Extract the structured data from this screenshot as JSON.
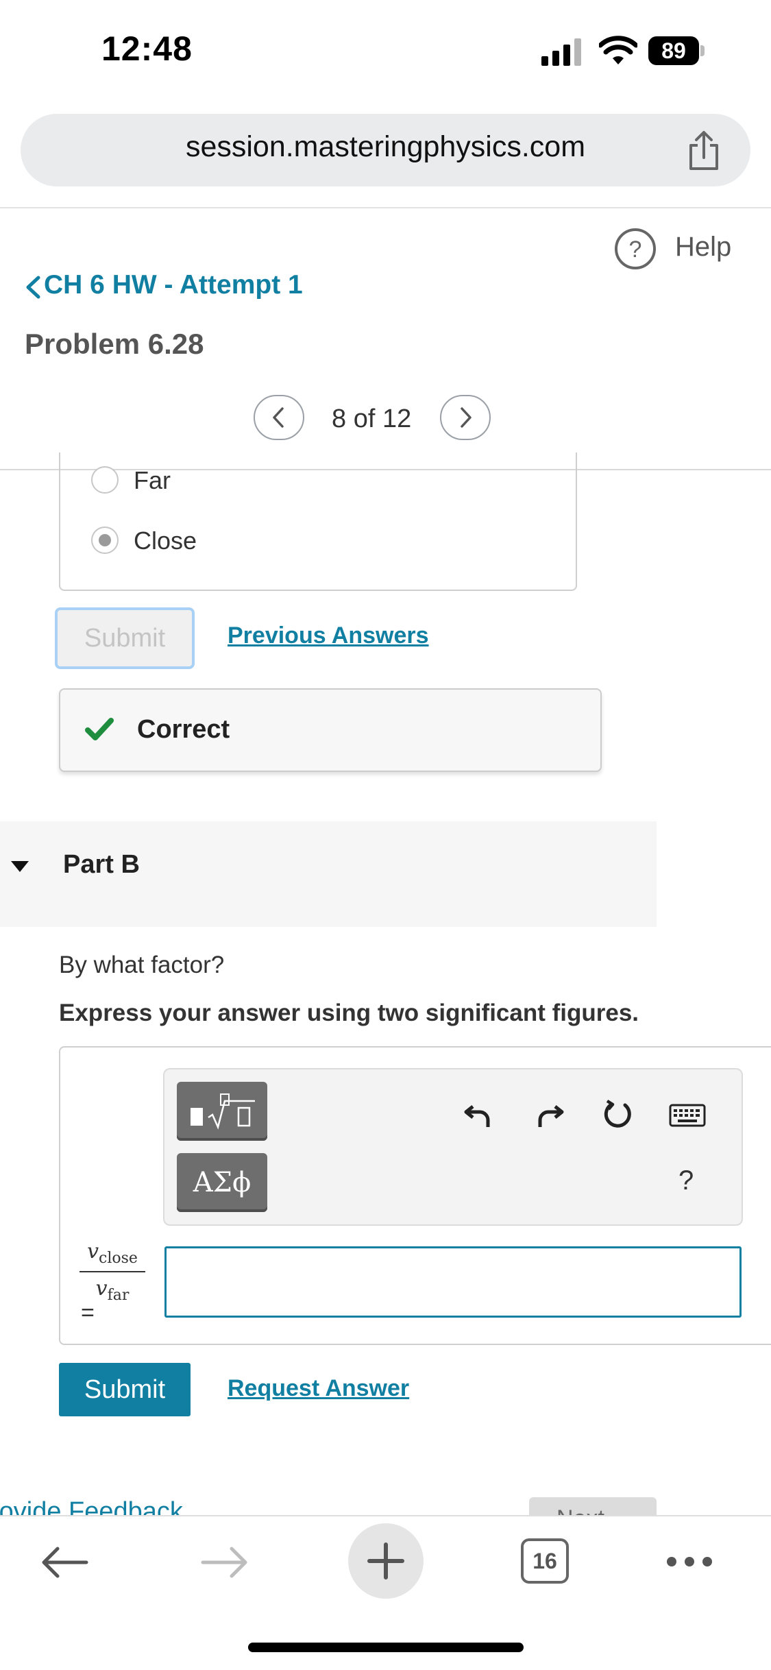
{
  "status_bar": {
    "time": "12:48",
    "battery": "89"
  },
  "browser": {
    "url": "session.masteringphysics.com",
    "tab_count": "16"
  },
  "header": {
    "help_label": "Help",
    "back_link": "CH 6 HW - Attempt 1",
    "problem_title": "Problem 6.28",
    "nav_count": "8 of 12"
  },
  "part_a": {
    "options": [
      "Far",
      "Close"
    ],
    "selected": "Close",
    "submit_label": "Submit",
    "previous_answers": "Previous Answers",
    "result": "Correct"
  },
  "part_b": {
    "title": "Part B",
    "question": "By what factor?",
    "instruction": "Express your answer using two significant figures.",
    "greek_button": "ΑΣϕ",
    "help_mark": "?",
    "fraction": {
      "num_var": "v",
      "num_sub": "close",
      "den_var": "v",
      "den_sub": "far",
      "equals": "="
    },
    "answer_value": "",
    "submit_label": "Submit",
    "request_answer": "Request Answer"
  },
  "footer": {
    "feedback_partial": "rovide Feedback",
    "next_partial": "Next"
  },
  "colors": {
    "link": "#117fa2",
    "correct": "#1e8e3e",
    "primary_button": "#117fa2"
  }
}
